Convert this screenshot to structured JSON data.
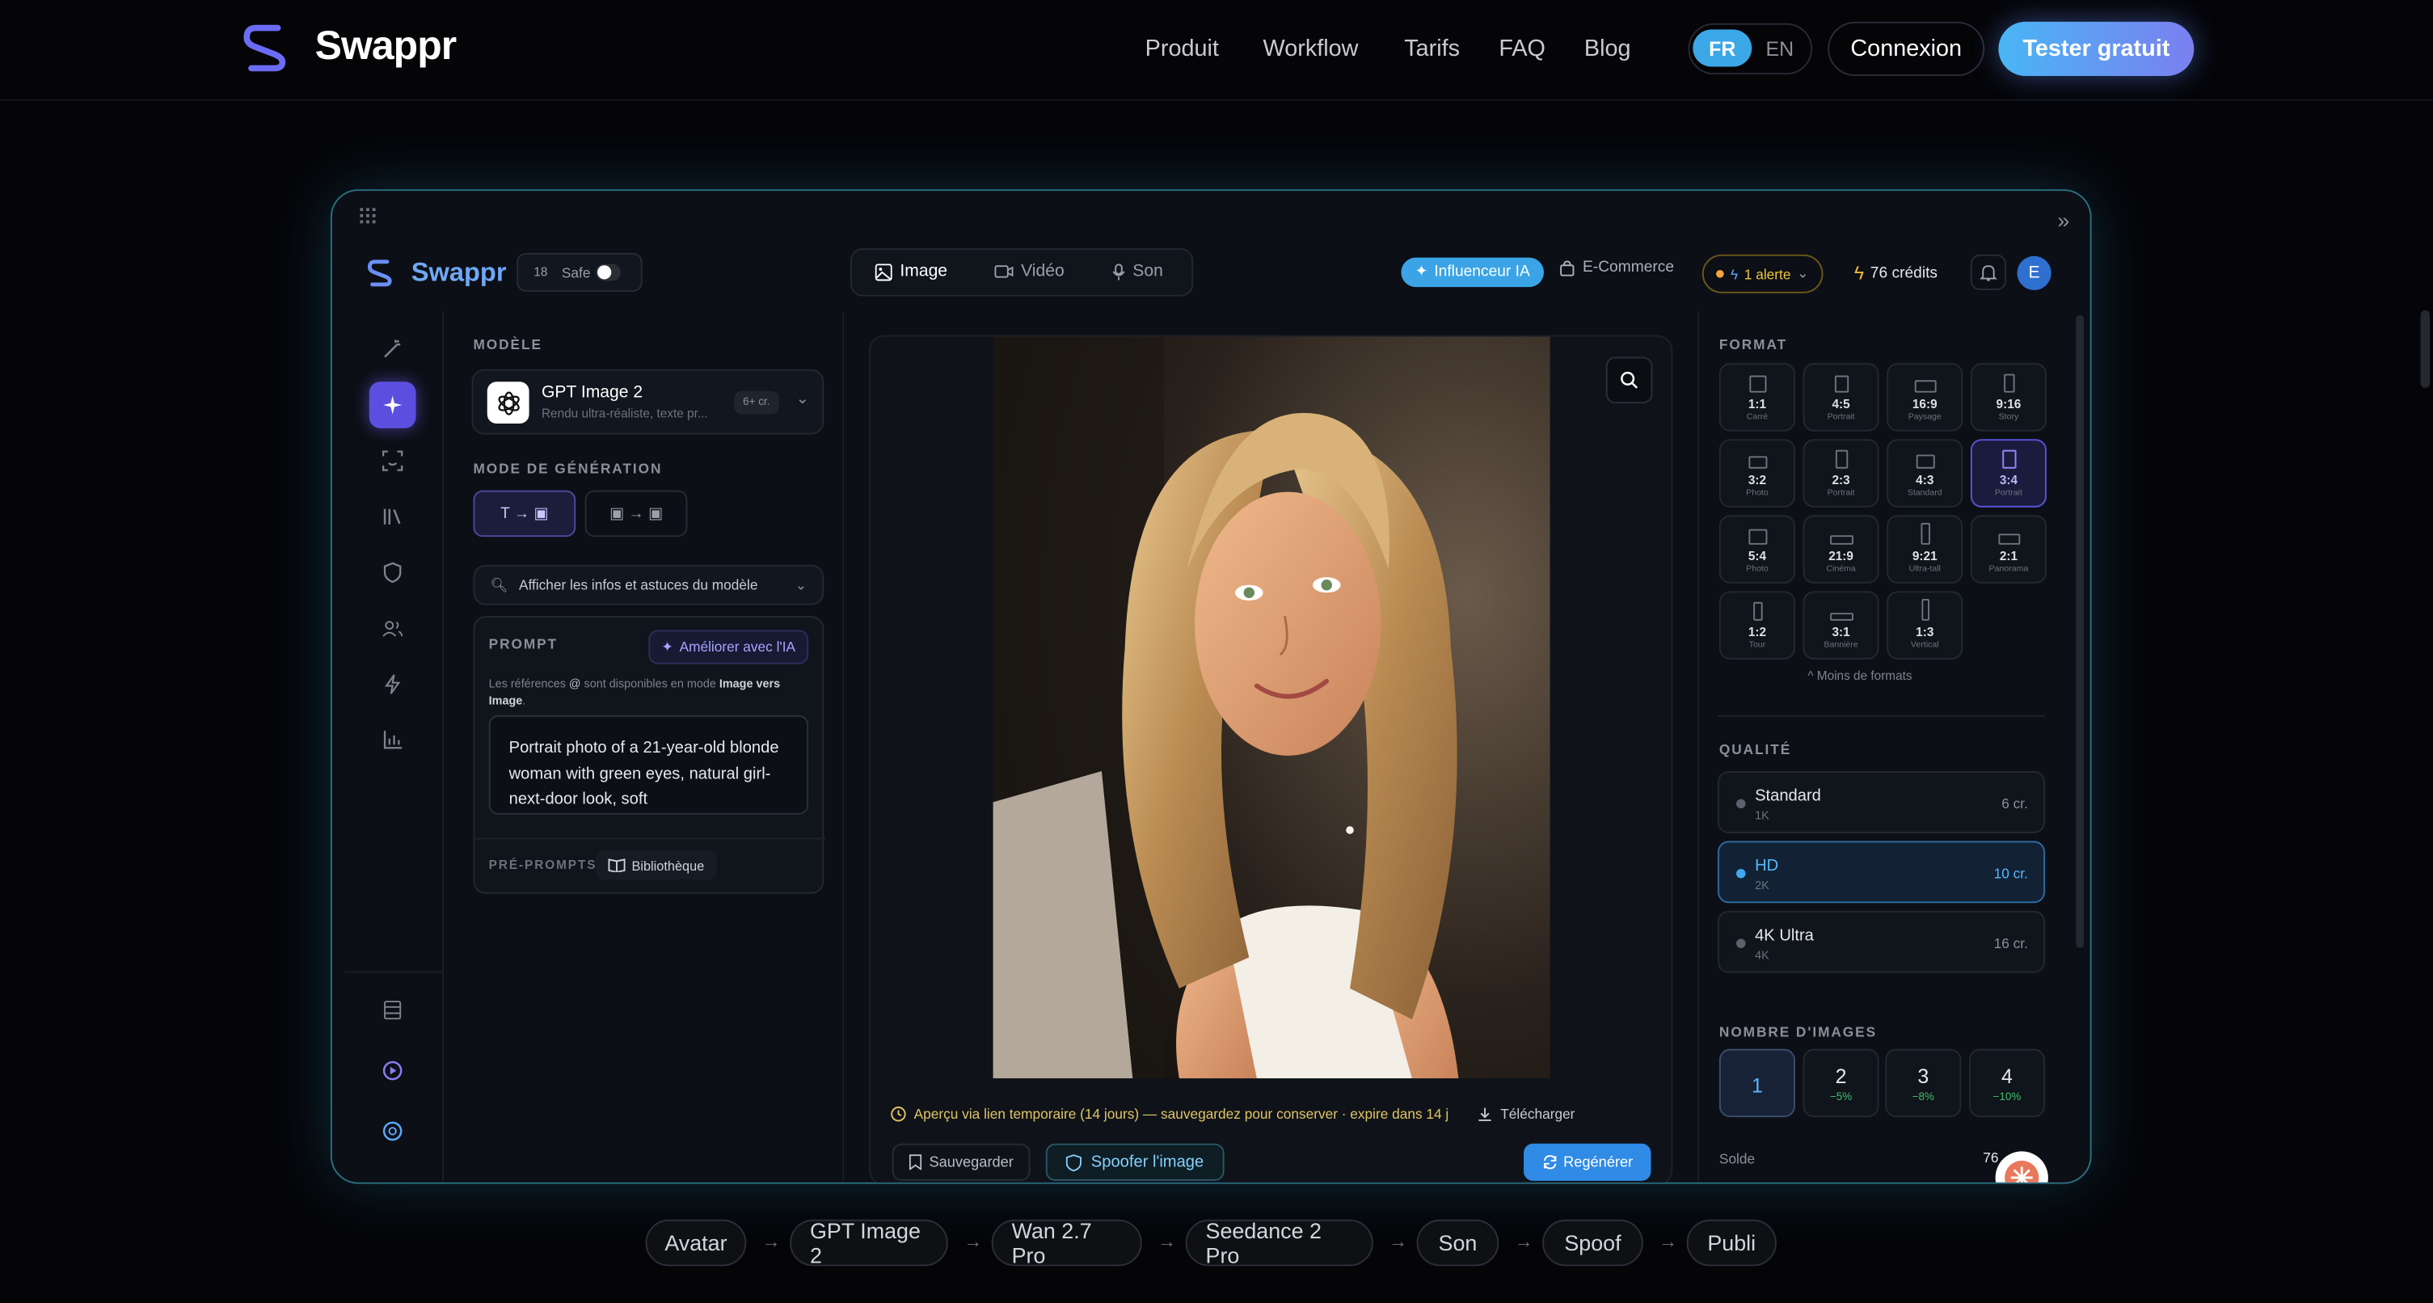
{
  "site": {
    "brand": "Swappr",
    "nav": [
      "Produit",
      "Workflow",
      "Tarifs",
      "FAQ",
      "Blog"
    ],
    "lang_fr": "FR",
    "lang_en": "EN",
    "login": "Connexion",
    "cta": "Tester gratuit"
  },
  "app": {
    "brand": "Swappr",
    "safe_age": "18",
    "safe_label": "Safe",
    "tabs": [
      "Image",
      "Vidéo",
      "Son"
    ],
    "influencer": "Influenceur IA",
    "ecommerce": "E-Commerce",
    "alert": "1 alerte",
    "credits": "76 crédits",
    "avatar_letter": "E"
  },
  "left": {
    "model_label": "MODÈLE",
    "model_name": "GPT Image 2",
    "model_desc": "Rendu ultra-réaliste, texte pr...",
    "model_cost": "6+ cr.",
    "mode_label": "MODE DE GÉNÉRATION",
    "mode_t2i": "T → ▣",
    "mode_i2i": "▣ → ▣",
    "tips": "Afficher les infos et astuces du modèle",
    "prompt_label": "PROMPT",
    "improve": "Améliorer avec l'IA",
    "note_a": "Les références ",
    "note_at": "@",
    "note_b": " sont disponibles en mode ",
    "note_bold": "Image vers Image",
    "note_end": ".",
    "prompt_text": "Portrait photo of a 21-year-old blonde woman with green eyes, natural girl-next-door look, soft",
    "preprompts": "PRÉ-PROMPTS",
    "library": "Bibliothèque"
  },
  "center": {
    "notice": "Aperçu via lien temporaire (14 jours) — sauvegardez pour conserver · expire dans 14 j",
    "download": "Télécharger",
    "save": "Sauvegarder",
    "spoof": "Spoofer l'image",
    "regen": "Regénérer"
  },
  "right": {
    "format_label": "FORMAT",
    "formats": [
      {
        "r": "1:1",
        "s": "Carré"
      },
      {
        "r": "4:5",
        "s": "Portrait"
      },
      {
        "r": "16:9",
        "s": "Paysage"
      },
      {
        "r": "9:16",
        "s": "Story"
      },
      {
        "r": "3:2",
        "s": "Photo"
      },
      {
        "r": "2:3",
        "s": "Portrait"
      },
      {
        "r": "4:3",
        "s": "Standard"
      },
      {
        "r": "3:4",
        "s": "Portrait"
      },
      {
        "r": "5:4",
        "s": "Photo"
      },
      {
        "r": "21:9",
        "s": "Cinéma"
      },
      {
        "r": "9:21",
        "s": "Ultra-tall"
      },
      {
        "r": "2:1",
        "s": "Panorama"
      },
      {
        "r": "1:2",
        "s": "Tour"
      },
      {
        "r": "3:1",
        "s": "Bannière"
      },
      {
        "r": "1:3",
        "s": "Vertical"
      }
    ],
    "fewer": "^ Moins de formats",
    "quality_label": "QUALITÉ",
    "qualities": [
      {
        "n": "Standard",
        "s": "1K",
        "c": "6 cr."
      },
      {
        "n": "HD",
        "s": "2K",
        "c": "10 cr."
      },
      {
        "n": "4K Ultra",
        "s": "4K",
        "c": "16 cr."
      }
    ],
    "count_label": "NOMBRE D'IMAGES",
    "counts": [
      {
        "n": "1",
        "d": ""
      },
      {
        "n": "2",
        "d": "−5%"
      },
      {
        "n": "3",
        "d": "−8%"
      },
      {
        "n": "4",
        "d": "−10%"
      }
    ],
    "balance_label": "Solde",
    "balance_value": "76"
  },
  "pipeline": [
    "Avatar",
    "GPT Image 2",
    "Wan 2.7 Pro",
    "Seedance 2 Pro",
    "Son",
    "Spoof",
    "Publi"
  ]
}
